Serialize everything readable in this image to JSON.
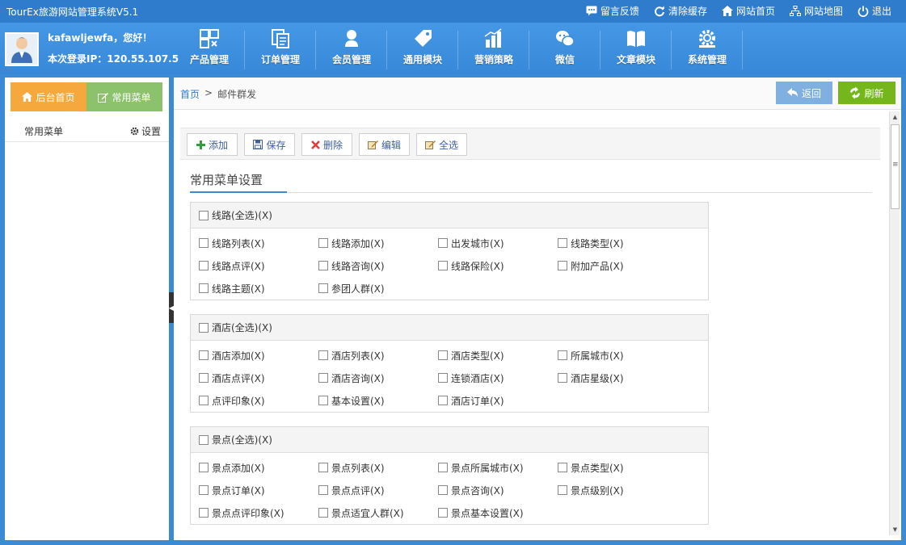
{
  "app": {
    "title": "TourEx旅游网站管理系统V5.1"
  },
  "top_links": [
    {
      "icon": "feedback-icon",
      "label": "留言反馈"
    },
    {
      "icon": "refresh-cache-icon",
      "label": "清除缓存"
    },
    {
      "icon": "home-icon",
      "label": "网站首页"
    },
    {
      "icon": "sitemap-icon",
      "label": "网站地图"
    },
    {
      "icon": "power-icon",
      "label": "退出"
    }
  ],
  "user": {
    "greeting": "kafawljewfa，您好！",
    "login_ip": "本次登录IP：120.55.107.5"
  },
  "nav": [
    {
      "icon": "product-grid-icon",
      "label": "产品管理"
    },
    {
      "icon": "order-doc-icon",
      "label": "订单管理"
    },
    {
      "icon": "member-icon",
      "label": "会员管理"
    },
    {
      "icon": "tag-icon",
      "label": "通用模块"
    },
    {
      "icon": "bar-chart-icon",
      "label": "营销策略"
    },
    {
      "icon": "wechat-icon",
      "label": "微信"
    },
    {
      "icon": "book-icon",
      "label": "文章模块"
    },
    {
      "icon": "gear-icon",
      "label": "系统管理"
    }
  ],
  "sidebar": {
    "home_button": "后台首页",
    "menu_button": "常用菜单",
    "row_label": "常用菜单",
    "settings_label": "设置"
  },
  "breadcrumb": {
    "home": "首页",
    "separator": ">",
    "current": "邮件群发"
  },
  "actions": {
    "back": "返回",
    "refresh": "刷新"
  },
  "toolbar": {
    "add": "添加",
    "save": "保存",
    "delete": "删除",
    "edit": "编辑",
    "select_all": "全选"
  },
  "section_title": "常用菜单设置",
  "groups": [
    {
      "title": "线路(全选)(X)",
      "items": [
        "线路列表(X)",
        "线路添加(X)",
        "出发城市(X)",
        "线路类型(X)",
        "线路点评(X)",
        "线路咨询(X)",
        "线路保险(X)",
        "附加产品(X)",
        "线路主题(X)",
        "参团人群(X)"
      ]
    },
    {
      "title": "酒店(全选)(X)",
      "items": [
        "酒店添加(X)",
        "酒店列表(X)",
        "酒店类型(X)",
        "所属城市(X)",
        "酒店点评(X)",
        "酒店咨询(X)",
        "连锁酒店(X)",
        "酒店星级(X)",
        "点评印象(X)",
        "基本设置(X)",
        "酒店订单(X)"
      ]
    },
    {
      "title": "景点(全选)(X)",
      "items": [
        "景点添加(X)",
        "景点列表(X)",
        "景点所属城市(X)",
        "景点类型(X)",
        "景点订单(X)",
        "景点点评(X)",
        "景点咨询(X)",
        "景点级别(X)",
        "景点点评印象(X)",
        "景点适宜人群(X)",
        "景点基本设置(X)"
      ]
    }
  ],
  "colors": {
    "header_blue": "#3b8ad6",
    "home_orange": "#f5a93d",
    "menu_green": "#8cc26c",
    "refresh_green": "#75b61d",
    "back_blue": "#7fb0df"
  }
}
